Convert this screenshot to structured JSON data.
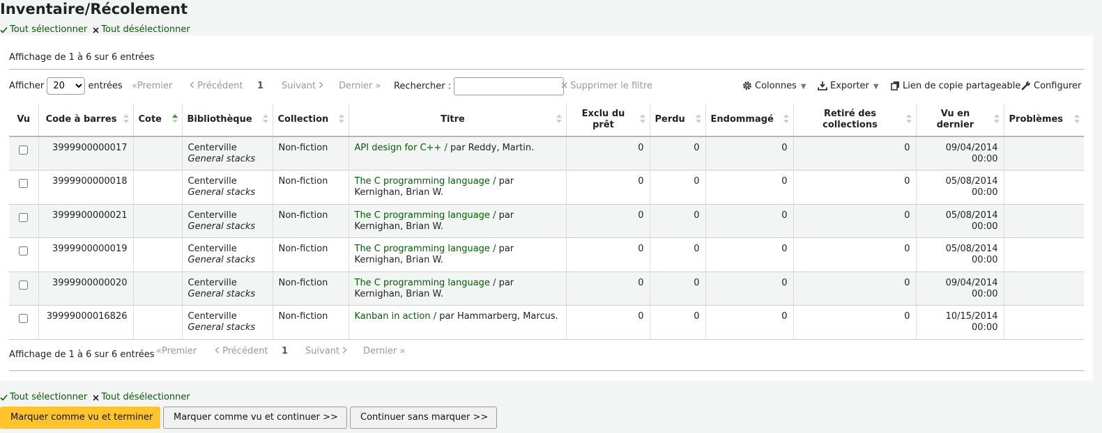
{
  "page": {
    "title": "Inventaire/Récolement"
  },
  "selection": {
    "select_all": "Tout sélectionner",
    "deselect_all": "Tout désélectionner"
  },
  "table_info": {
    "top": "Affichage de 1 à 6 sur 6 entrées",
    "bottom": "Affichage de 1 à 6 sur 6 entrées"
  },
  "toolbar": {
    "show_label": "Afficher",
    "show_value": "20",
    "entries_label": "entrées",
    "search_label": "Rechercher :",
    "search_value": "",
    "clear_filter": "Supprimer le filtre",
    "columns": "Colonnes",
    "export": "Exporter",
    "share_link": "Lien de copie partageable",
    "configure": "Configurer"
  },
  "pagination": {
    "first": "Premier",
    "previous": "Précédent",
    "current": "1",
    "next": "Suivant",
    "last": "Dernier"
  },
  "columns": [
    "Vu",
    "Code à barres",
    "Cote",
    "Bibliothèque",
    "Collection",
    "Titre",
    "Exclu du prêt",
    "Perdu",
    "Endommagé",
    "Retiré des collections",
    "Vu en dernier",
    "Problèmes"
  ],
  "rows": [
    {
      "barcode": "3999900000017",
      "callnumber": "",
      "library": "Centerville",
      "location": "General stacks",
      "collection": "Non-fiction",
      "title": "API design for C++ /",
      "author": "par Reddy, Martin.",
      "notforloan": "0",
      "lost": "0",
      "damaged": "0",
      "withdrawn": "0",
      "lastseen_date": "09/04/2014",
      "lastseen_time": "00:00",
      "problems": ""
    },
    {
      "barcode": "3999900000018",
      "callnumber": "",
      "library": "Centerville",
      "location": "General stacks",
      "collection": "Non-fiction",
      "title": "The C programming language /",
      "author": "par Kernighan, Brian W.",
      "notforloan": "0",
      "lost": "0",
      "damaged": "0",
      "withdrawn": "0",
      "lastseen_date": "05/08/2014",
      "lastseen_time": "00:00",
      "problems": ""
    },
    {
      "barcode": "3999900000021",
      "callnumber": "",
      "library": "Centerville",
      "location": "General stacks",
      "collection": "Non-fiction",
      "title": "The C programming language /",
      "author": "par Kernighan, Brian W.",
      "notforloan": "0",
      "lost": "0",
      "damaged": "0",
      "withdrawn": "0",
      "lastseen_date": "05/08/2014",
      "lastseen_time": "00:00",
      "problems": ""
    },
    {
      "barcode": "3999900000019",
      "callnumber": "",
      "library": "Centerville",
      "location": "General stacks",
      "collection": "Non-fiction",
      "title": "The C programming language /",
      "author": "par Kernighan, Brian W.",
      "notforloan": "0",
      "lost": "0",
      "damaged": "0",
      "withdrawn": "0",
      "lastseen_date": "05/08/2014",
      "lastseen_time": "00:00",
      "problems": ""
    },
    {
      "barcode": "3999900000020",
      "callnumber": "",
      "library": "Centerville",
      "location": "General stacks",
      "collection": "Non-fiction",
      "title": "The C programming language /",
      "author": "par Kernighan, Brian W.",
      "notforloan": "0",
      "lost": "0",
      "damaged": "0",
      "withdrawn": "0",
      "lastseen_date": "09/04/2014",
      "lastseen_time": "00:00",
      "problems": ""
    },
    {
      "barcode": "39999000016826",
      "callnumber": "",
      "library": "Centerville",
      "location": "General stacks",
      "collection": "Non-fiction",
      "title": "Kanban in action /",
      "author": "par Hammarberg, Marcus.",
      "notforloan": "0",
      "lost": "0",
      "damaged": "0",
      "withdrawn": "0",
      "lastseen_date": "10/15/2014",
      "lastseen_time": "00:00",
      "problems": ""
    }
  ],
  "buttons": {
    "finish": "Marquer comme vu et terminer",
    "continue": "Marquer comme vu et continuer >>",
    "skip": "Continuer sans marquer >>"
  },
  "colors": {
    "link": "#006100",
    "primary_button": "#ffc32b",
    "sort_active": "#2e9c2e"
  },
  "icons": [
    "check-icon",
    "x-icon",
    "gear-icon",
    "download-icon",
    "copy-icon",
    "wrench-icon",
    "chevron-left-icon",
    "chevron-right-icon",
    "sort-icon"
  ]
}
